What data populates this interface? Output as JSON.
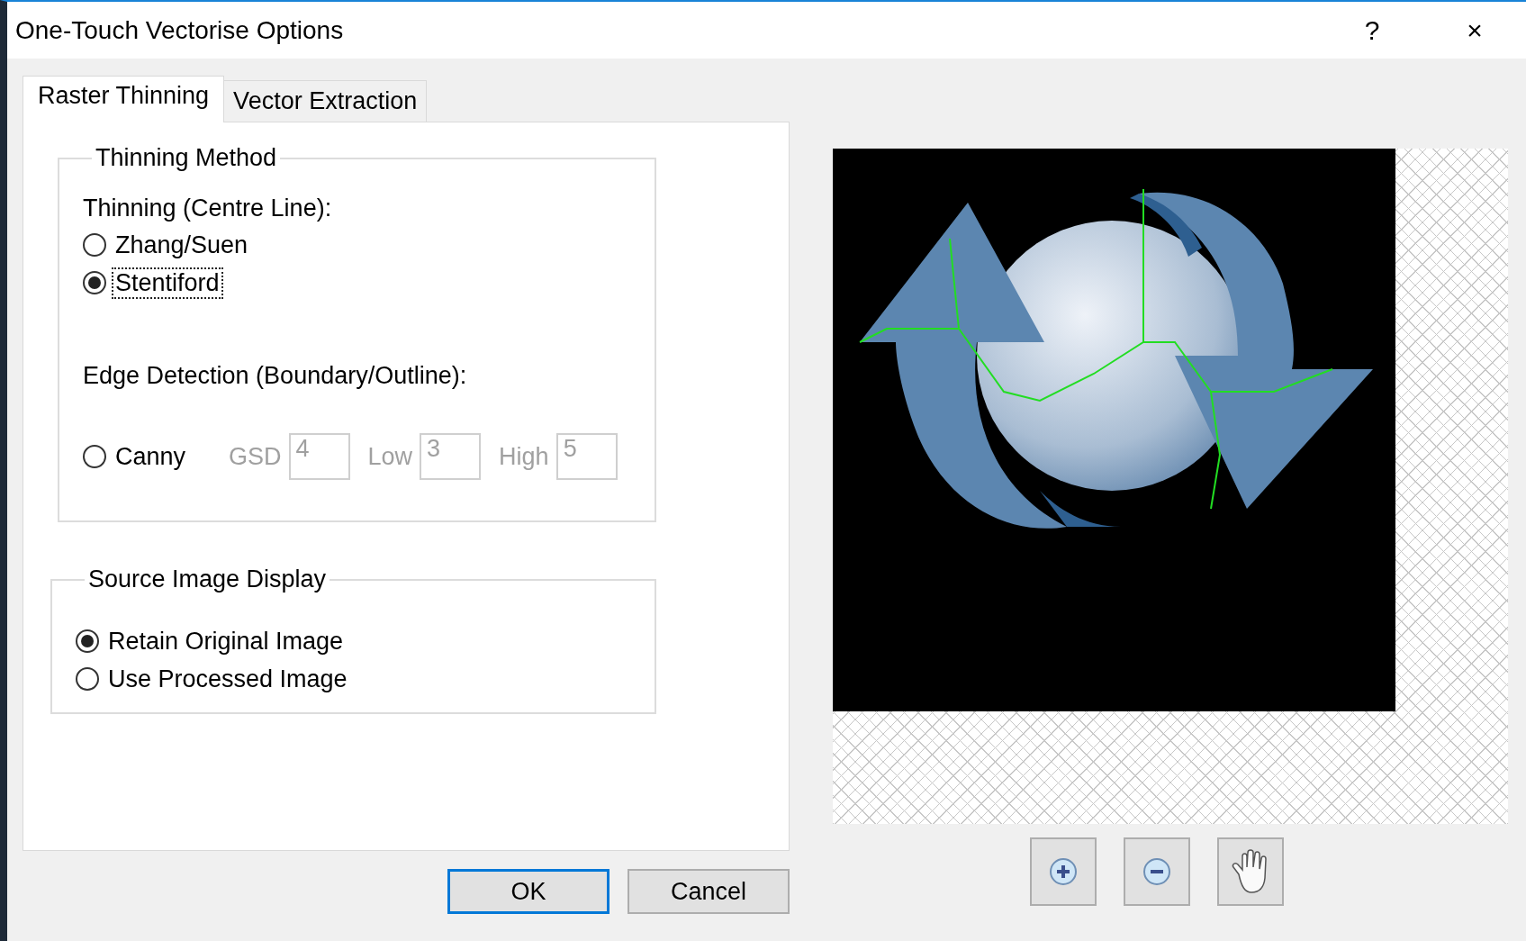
{
  "window": {
    "title": "One-Touch Vectorise Options",
    "help": "?",
    "close": "×"
  },
  "tabs": [
    {
      "label": "Raster Thinning",
      "selected": true
    },
    {
      "label": "Vector Extraction",
      "selected": false
    }
  ],
  "thinning_method": {
    "title": "Thinning Method",
    "thinning_label": "Thinning (Centre Line):",
    "options": [
      {
        "label": "Zhang/Suen",
        "selected": false,
        "focused": false
      },
      {
        "label": "Stentiford",
        "selected": true,
        "focused": true
      }
    ],
    "edge_label": "Edge Detection (Boundary/Outline):",
    "canny": {
      "label": "Canny",
      "selected": false
    },
    "params": [
      {
        "label": "GSD",
        "value": "4",
        "disabled": true
      },
      {
        "label": "Low",
        "value": "3",
        "disabled": true
      },
      {
        "label": "High",
        "value": "5",
        "disabled": true
      }
    ]
  },
  "source_image_display": {
    "title": "Source Image Display",
    "options": [
      {
        "label": "Retain Original Image",
        "selected": true
      },
      {
        "label": "Use Processed Image",
        "selected": false
      }
    ]
  },
  "buttons": [
    {
      "label": "OK",
      "default": true
    },
    {
      "label": "Cancel",
      "default": false
    }
  ],
  "tools": [
    {
      "kind": "zoom-in"
    },
    {
      "kind": "zoom-out"
    },
    {
      "kind": "pan"
    }
  ]
}
